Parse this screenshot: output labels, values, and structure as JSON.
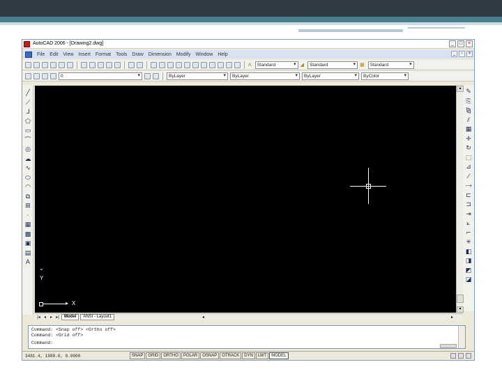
{
  "window": {
    "title": "AutoCAD 2006 - [Drawing2.dwg]",
    "controls": {
      "minimize": "_",
      "maximize": "□",
      "close": "×"
    },
    "doc_controls": {
      "minimize": "_",
      "restore": "▫",
      "close": "×"
    }
  },
  "menu": {
    "items": [
      "File",
      "Edit",
      "View",
      "Insert",
      "Format",
      "Tools",
      "Draw",
      "Dimension",
      "Modify",
      "Window",
      "Help"
    ]
  },
  "toolbar": {
    "text_style": "Standard",
    "dim_style": "Standard",
    "table_style": "Standard",
    "layer": "0",
    "color": "ByLayer",
    "linetype": "ByLayer",
    "lineweight": "ByLayer",
    "plot_style": "ByColor"
  },
  "left_tools": [
    {
      "icon": "line-icon",
      "glyph": "╱"
    },
    {
      "icon": "construction-line-icon",
      "glyph": "⟋"
    },
    {
      "icon": "polyline-icon",
      "glyph": "ᒧ"
    },
    {
      "icon": "polygon-icon",
      "glyph": "⬠"
    },
    {
      "icon": "rectangle-icon",
      "glyph": "▭"
    },
    {
      "icon": "arc-icon",
      "glyph": "⌒"
    },
    {
      "icon": "circle-icon",
      "glyph": "◎"
    },
    {
      "icon": "revision-cloud-icon",
      "glyph": "☁"
    },
    {
      "icon": "spline-icon",
      "glyph": "∿"
    },
    {
      "icon": "ellipse-icon",
      "glyph": "⬭"
    },
    {
      "icon": "ellipse-arc-icon",
      "glyph": "◠"
    },
    {
      "icon": "insert-block-icon",
      "glyph": "⧉"
    },
    {
      "icon": "make-block-icon",
      "glyph": "⊞"
    },
    {
      "icon": "point-icon",
      "glyph": "·"
    },
    {
      "icon": "hatch-icon",
      "glyph": "▦"
    },
    {
      "icon": "gradient-icon",
      "glyph": "▩"
    },
    {
      "icon": "region-icon",
      "glyph": "▣"
    },
    {
      "icon": "table-icon",
      "glyph": "▤"
    },
    {
      "icon": "multiline-text-icon",
      "glyph": "A"
    }
  ],
  "right_tools": [
    {
      "icon": "erase-icon",
      "glyph": "✎"
    },
    {
      "icon": "copy-icon",
      "glyph": "⎘"
    },
    {
      "icon": "mirror-icon",
      "glyph": "⧎"
    },
    {
      "icon": "offset-icon",
      "glyph": "⫽"
    },
    {
      "icon": "array-icon",
      "glyph": "▦"
    },
    {
      "icon": "move-icon",
      "glyph": "✛"
    },
    {
      "icon": "rotate-icon",
      "glyph": "↻"
    },
    {
      "icon": "scale-icon",
      "glyph": "⬚"
    },
    {
      "icon": "stretch-icon",
      "glyph": "⊿"
    },
    {
      "icon": "trim-icon",
      "glyph": "⁄"
    },
    {
      "icon": "extend-icon",
      "glyph": "⤍"
    },
    {
      "icon": "break-at-point-icon",
      "glyph": "⊏"
    },
    {
      "icon": "break-icon",
      "glyph": "⊐"
    },
    {
      "icon": "join-icon",
      "glyph": "⇥"
    },
    {
      "icon": "chamfer-icon",
      "glyph": "⟀"
    },
    {
      "icon": "fillet-icon",
      "glyph": "⌐"
    },
    {
      "icon": "explode-icon",
      "glyph": "✳"
    },
    {
      "icon": "draworder-front-icon",
      "glyph": "◧"
    },
    {
      "icon": "draworder-back-icon",
      "glyph": "◨"
    },
    {
      "icon": "draworder-above-icon",
      "glyph": "◩"
    },
    {
      "icon": "draworder-under-icon",
      "glyph": "◪"
    }
  ],
  "ucs": {
    "x_label": "X",
    "y_label": "Y"
  },
  "layout_tabs": [
    "Model",
    "ANSI - Layout1"
  ],
  "command": {
    "line1": "Command: <Snap off> <Ortho off>",
    "line2": "Command: <Grid off>",
    "prompt": "Command:"
  },
  "status": {
    "coords": "3481.4, 1988.0, 0.0000",
    "buttons": [
      "SNAP",
      "GRID",
      "ORTHO",
      "POLAR",
      "OSNAP",
      "OTRACK",
      "DYN",
      "LWT",
      "MODEL"
    ]
  }
}
